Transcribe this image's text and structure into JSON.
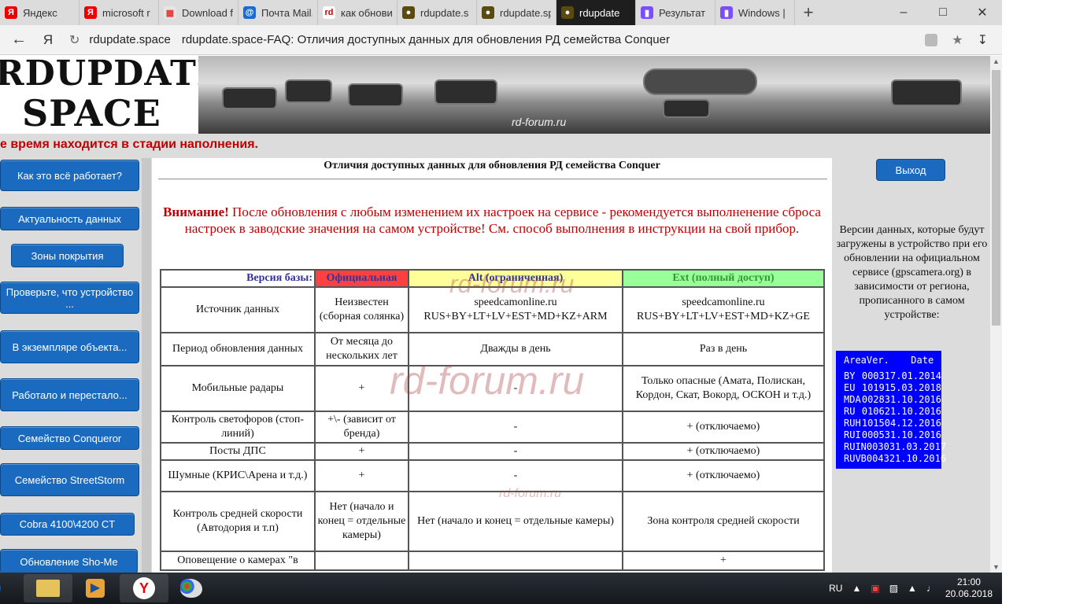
{
  "browser": {
    "tabs": [
      {
        "label": "Яндекс",
        "icon": "yandex-icon",
        "color": "#fff"
      },
      {
        "label": "microsoft r",
        "icon": "yandex-icon",
        "color": "#fff"
      },
      {
        "label": "Download f",
        "icon": "windows-icon",
        "color": "#fff"
      },
      {
        "label": "Почта Mail.",
        "icon": "mail-icon",
        "color": "#fff"
      },
      {
        "label": "как обнови",
        "icon": "rd-icon",
        "color": "#fff"
      },
      {
        "label": "rdupdate.s",
        "icon": "rdupdate-icon",
        "color": "#fff"
      },
      {
        "label": "rdupdate.sp",
        "icon": "rdupdate-icon",
        "color": "#fff"
      },
      {
        "label": "rdupdate",
        "icon": "rdupdate-icon",
        "color": "#1e1e1e"
      },
      {
        "label": "Результат",
        "icon": "purple-icon",
        "color": "#fff"
      },
      {
        "label": "Windows |",
        "icon": "purple-icon",
        "color": "#fff"
      }
    ],
    "host": "rdupdate.space",
    "page_title": "rdupdate.space-FAQ: Отличия доступных данных для обновления РД семейства Conquer"
  },
  "site": {
    "logo_line1": "RDUPDATE",
    "logo_line2": "SPACE",
    "banner_watermark": "rd-forum.ru",
    "marquee": "е время находится в стадии наполнения."
  },
  "sidebar": {
    "items": [
      "Как это всё работает?",
      "Актуальность данных",
      "Зоны покрытия",
      "Проверьте, что устройство ...",
      "В экземпляре объекта...",
      "Работало и перестало...",
      "Семейство Conqueror",
      "Семейство StreetStorm",
      "Cobra 4100\\4200 CT",
      "Обновление Sho-Me"
    ]
  },
  "content": {
    "title": "Отличия доступных данных для обновления РД семейства Conquer",
    "warning_bold": "Внимание!",
    "warning_text": " После обновления с любым изменением их настроек на сервисе - рекомендуется выполненение сброса настроек в заводские значения на самом устройстве! См. способ выполнения в инструкции на свой прибор.",
    "watermark": "rd-forum.ru",
    "table": {
      "headers": [
        "Версия базы:",
        "Официальная",
        "Alt (ограниченная)",
        "Ext (полный доступ)"
      ],
      "header_colors": [
        "#ffffff",
        "#ff4040",
        "#ffff99",
        "#99ff99"
      ],
      "header_text_colors": [
        "#333399",
        "#333399",
        "#333399",
        "#339933"
      ],
      "rows": [
        [
          "Источник данных",
          "Неизвестен (сборная солянка)",
          "speedcamonline.ru RUS+BY+LT+LV+EST+MD+KZ+ARM",
          "speedcamonline.ru RUS+BY+LT+LV+EST+MD+KZ+GE"
        ],
        [
          "Период обновления данных",
          "От месяца до нескольких лет",
          "Дважды в день",
          "Раз в день"
        ],
        [
          "Мобильные радары",
          "+",
          "-",
          "Только опасные (Амата, Полискан, Кордон, Скат, Вокорд, ОСКОН и т.д.)"
        ],
        [
          "Контроль светофоров (стоп-линий)",
          "+\\- (зависит от бренда)",
          "-",
          "+ (отключаемо)"
        ],
        [
          "Посты ДПС",
          "+",
          "-",
          "+ (отключаемо)"
        ],
        [
          "Шумные (КРИС\\Арена и т.д.)",
          "+",
          "-",
          "+ (отключаемо)"
        ],
        [
          "Контроль средней скорости (Автодория и т.п)",
          "Нет (начало и конец = отдельные камеры)",
          "Нет (начало и конец = отдельные камеры)",
          "Зона контроля средней скорости"
        ],
        [
          "Оповещение о камерах \"в",
          "",
          "",
          "+"
        ]
      ]
    }
  },
  "right_panel": {
    "exit_label": "Выход",
    "info_text": "Версии данных, которые будут загружены в устройство при его обновлении на официальном сервисе (gpscamera.org) в зависимости от региона, прописанного в самом устройстве:",
    "versions_header": [
      "Area",
      "Ver.",
      "Date"
    ],
    "versions": [
      [
        "BY",
        "0003",
        "17.01.2014"
      ],
      [
        "EU",
        "1019",
        "15.03.2018"
      ],
      [
        "MDA",
        "0028",
        "31.10.2016"
      ],
      [
        "RU",
        "0106",
        "21.10.2016"
      ],
      [
        "RUH",
        "1015",
        "04.12.2016"
      ],
      [
        "RUI",
        "0005",
        "31.10.2016"
      ],
      [
        "RUIN",
        "0030",
        "31.03.2017"
      ],
      [
        "RUVB",
        "0043",
        "21.10.2016"
      ]
    ]
  },
  "taskbar": {
    "lang": "RU",
    "time": "21:00",
    "date": "20.06.2018"
  }
}
